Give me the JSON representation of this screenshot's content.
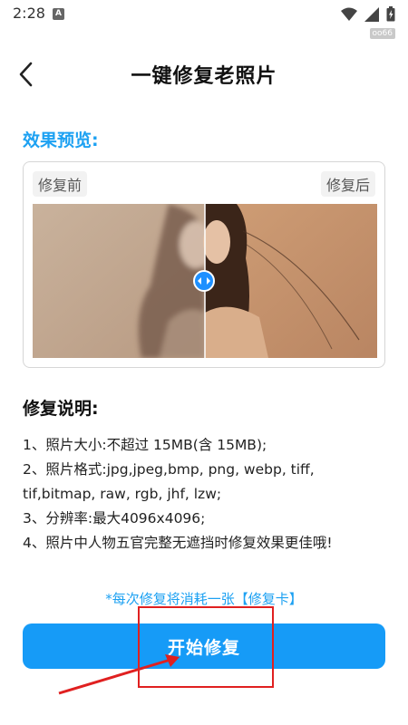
{
  "status_bar": {
    "time": "2:28",
    "app_icon_letter": "A",
    "tag": "oo66"
  },
  "header": {
    "title": "一键修复老照片"
  },
  "preview": {
    "section_title": "效果预览:",
    "before_label": "修复前",
    "after_label": "修复后"
  },
  "description": {
    "section_title": "修复说明:",
    "items": [
      "1、照片大小:不超过 15MB(含 15MB);",
      "2、照片格式:jpg,jpeg,bmp, png, webp, tiff,",
      "tif,bitmap, raw, rgb, jhf, lzw;",
      "3、分辨率:最大4096x4096;",
      "4、照片中人物五官完整无遮挡时修复效果更佳哦!"
    ]
  },
  "notice": "*每次修复将消耗一张【修复卡】",
  "start_button_label": "开始修复",
  "colors": {
    "accent": "#1da1f2",
    "button": "#169bf7",
    "highlight": "#e02020"
  }
}
